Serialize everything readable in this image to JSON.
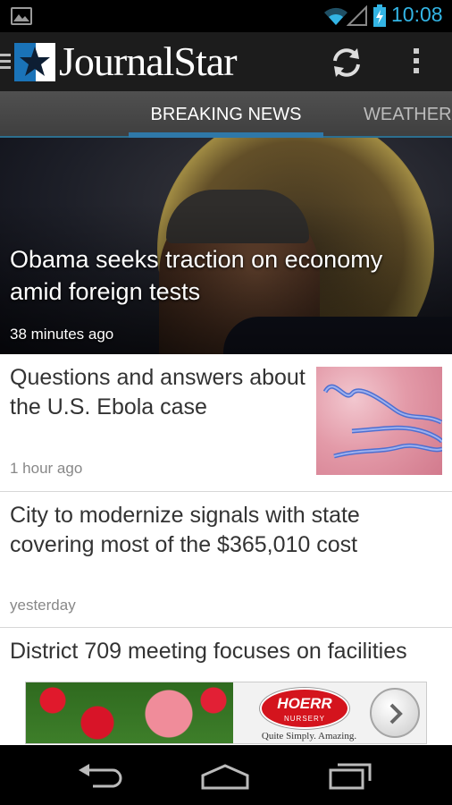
{
  "status_bar": {
    "time": "10:08",
    "icons": [
      "image-notification-icon",
      "wifi-icon",
      "signal-icon",
      "battery-charging-icon"
    ],
    "accent_color": "#33b5e5"
  },
  "app_bar": {
    "logo_text": "JournalStar",
    "actions": [
      "refresh-icon",
      "overflow-menu-icon"
    ]
  },
  "tabs": [
    {
      "label": "BREAKING NEWS",
      "selected": true
    },
    {
      "label": "WEATHER",
      "selected": false
    }
  ],
  "hero_story": {
    "title": "Obama seeks traction on economy amid foreign tests",
    "time": "38 minutes ago"
  },
  "stories": [
    {
      "title": "Questions and answers about the U.S. Ebola case",
      "time": "1 hour ago",
      "has_thumbnail": true
    },
    {
      "title": "City to modernize signals with state covering most of the $365,010 cost",
      "time": "yesterday",
      "has_thumbnail": false
    },
    {
      "title": "District 709 meeting focuses on facilities",
      "time": "",
      "has_thumbnail": false
    }
  ],
  "ad": {
    "logo_name": "HOERR",
    "logo_sub": "NURSERY",
    "tagline": "Quite Simply. Amazing."
  },
  "nav_bar": {
    "buttons": [
      "back-icon",
      "home-icon",
      "recent-apps-icon"
    ]
  }
}
